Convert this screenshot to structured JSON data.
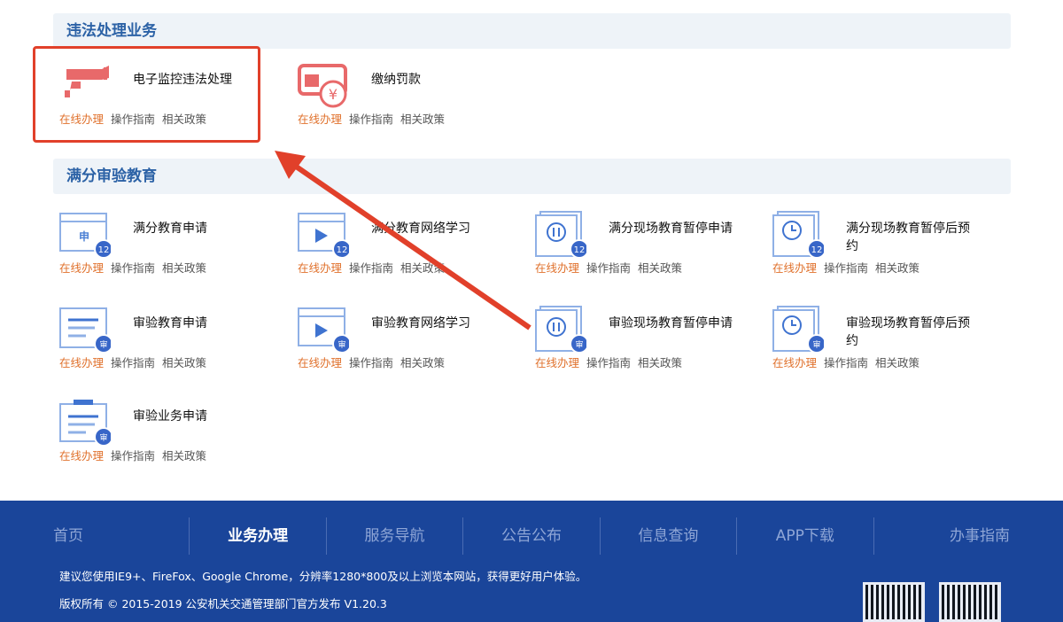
{
  "sections": [
    {
      "title": "违法处理业务",
      "items": [
        {
          "title": "电子监控违法处理",
          "icon": "camera-icon",
          "color": "#e8696a"
        },
        {
          "title": "缴纳罚款",
          "icon": "fine-payment-icon",
          "color": "#e8696a"
        }
      ]
    },
    {
      "title": "满分审验教育",
      "items": [
        {
          "title": "满分教育申请",
          "icon": "window-apply-icon",
          "badge": "12"
        },
        {
          "title": "满分教育网络学习",
          "icon": "video-learning-icon",
          "badge": "12"
        },
        {
          "title": "满分现场教育暂停申请",
          "icon": "pause-doc-icon",
          "badge": "12"
        },
        {
          "title": "满分现场教育暂停后预约",
          "icon": "clock-doc-icon",
          "badge": "12"
        },
        {
          "title": "审验教育申请",
          "icon": "doc-list-icon",
          "badge": "审"
        },
        {
          "title": "审验教育网络学习",
          "icon": "video-learning-icon",
          "badge": "审"
        },
        {
          "title": "审验现场教育暂停申请",
          "icon": "pause-doc-icon",
          "badge": "审"
        },
        {
          "title": "审验现场教育暂停后预约",
          "icon": "clock-doc-icon",
          "badge": "审"
        },
        {
          "title": "审验业务申请",
          "icon": "clipboard-icon",
          "badge": "审"
        }
      ]
    }
  ],
  "links": {
    "online": "在线办理",
    "guide": "操作指南",
    "policy": "相关政策"
  },
  "footer": {
    "nav": [
      "首页",
      "业务办理",
      "服务导航",
      "公告公布",
      "信息查询",
      "APP下载",
      "办事指南"
    ],
    "active": 1,
    "notice": "建议您使用IE9+、FireFox、Google Chrome，分辨率1280*800及以上浏览本网站，获得更好用户体验。",
    "copyright": "版权所有 © 2015-2019 公安机关交通管理部门官方发布 V1.20.3"
  },
  "colors": {
    "accent": "#e0712c",
    "primary": "#2c62a6",
    "footer": "#1a459a",
    "highlight": "#e1402a"
  }
}
